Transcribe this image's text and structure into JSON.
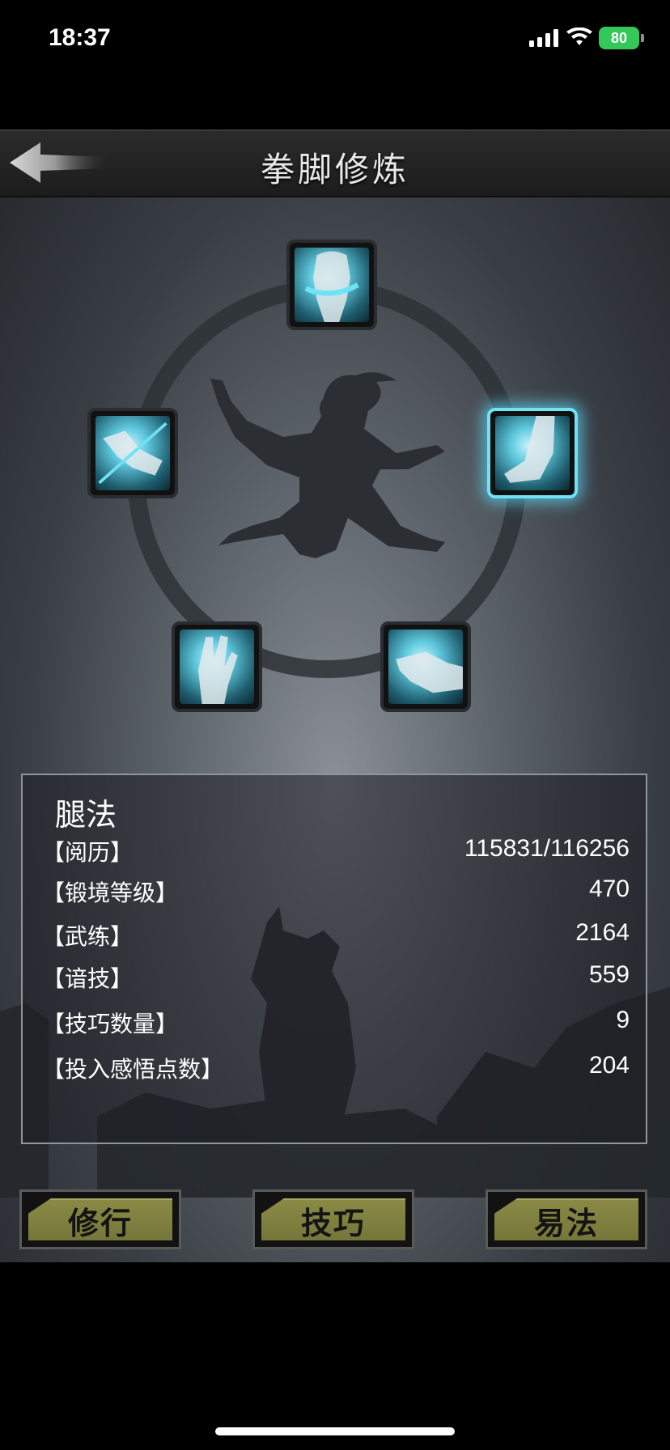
{
  "status_bar": {
    "time": "18:37",
    "battery": "80"
  },
  "header": {
    "title": "拳脚修炼"
  },
  "skills": [
    {
      "name": "fist",
      "icon": "fist-icon",
      "selected": false
    },
    {
      "name": "leg",
      "icon": "leg-icon",
      "selected": true
    },
    {
      "name": "elbow",
      "icon": "elbow-icon",
      "selected": false
    },
    {
      "name": "palm",
      "icon": "palm-icon",
      "selected": false
    },
    {
      "name": "finger",
      "icon": "finger-icon",
      "selected": false
    }
  ],
  "stats": {
    "title": "腿法",
    "rows": [
      {
        "label": "【阅历】",
        "value": "115831/116256"
      },
      {
        "label": "【锻境等级】",
        "value": "470"
      },
      {
        "label": "【武练】",
        "value": "2164"
      },
      {
        "label": "【谙技】",
        "value": "559"
      },
      {
        "label": "【技巧数量】",
        "value": "9"
      },
      {
        "label": "【投入感悟点数】",
        "value": "204"
      }
    ]
  },
  "buttons": {
    "train": "修行",
    "technique": "技巧",
    "change": "易法"
  },
  "colors": {
    "accent_glow": "#6fe2f5",
    "button_face": "#8a8a45",
    "battery": "#34c759"
  }
}
